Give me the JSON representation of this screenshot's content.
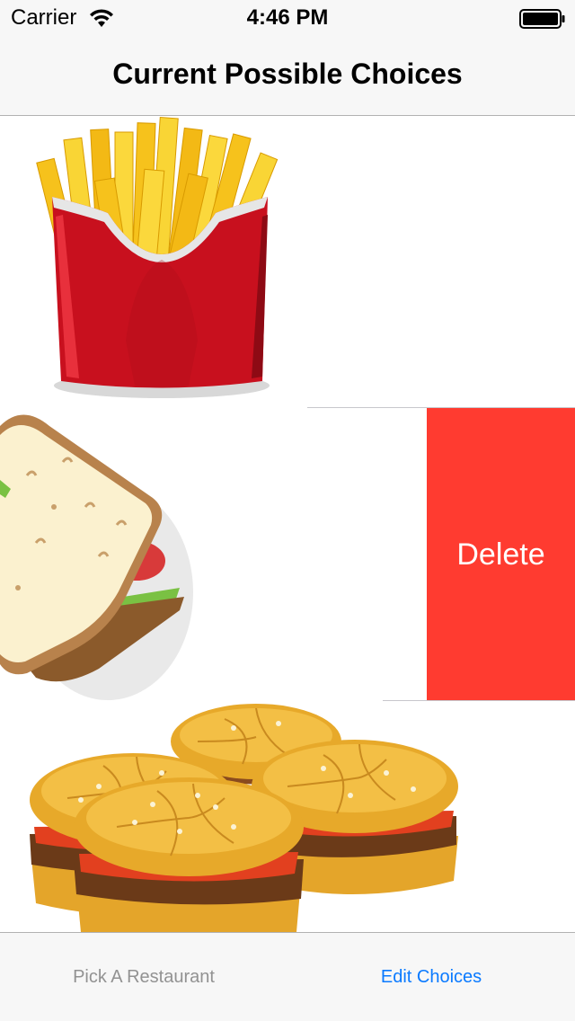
{
  "status_bar": {
    "carrier": "Carrier",
    "time": "4:46 PM"
  },
  "nav_bar": {
    "title": "Current Possible Choices"
  },
  "table": {
    "rows": [
      {
        "image": "french-fries"
      },
      {
        "image": "sandwich",
        "swipe_action": "Delete"
      },
      {
        "image": "burgers"
      }
    ]
  },
  "tab_bar": {
    "tabs": [
      {
        "label": "Pick A Restaurant",
        "selected": false
      },
      {
        "label": "Edit Choices",
        "selected": true
      }
    ]
  },
  "colors": {
    "delete": "#ff3b30",
    "tab_active": "#0a7aff",
    "tab_inactive": "#929292"
  }
}
